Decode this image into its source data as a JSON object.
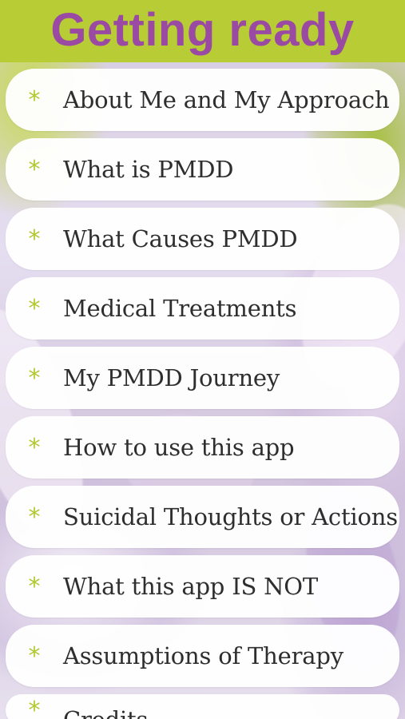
{
  "header": {
    "title": "Getting ready"
  },
  "menu": {
    "items": [
      {
        "label": "About Me and My Approach",
        "icon": "star-icon"
      },
      {
        "label": "What is PMDD",
        "icon": "star-icon"
      },
      {
        "label": "What Causes PMDD",
        "icon": "star-icon"
      },
      {
        "label": "Medical Treatments",
        "icon": "star-icon"
      },
      {
        "label": "My PMDD Journey",
        "icon": "star-icon"
      },
      {
        "label": "How to use this app",
        "icon": "star-icon"
      },
      {
        "label": "Suicidal Thoughts or Actions",
        "icon": "star-icon"
      },
      {
        "label": "What this app IS NOT",
        "icon": "star-icon"
      },
      {
        "label": "Assumptions of Therapy",
        "icon": "star-icon"
      },
      {
        "label": "Credits",
        "icon": "star-icon"
      }
    ]
  },
  "colors": {
    "header_bg": "#b7cc35",
    "title_text": "#9b4aa4",
    "accent_star": "#b2c82f"
  }
}
